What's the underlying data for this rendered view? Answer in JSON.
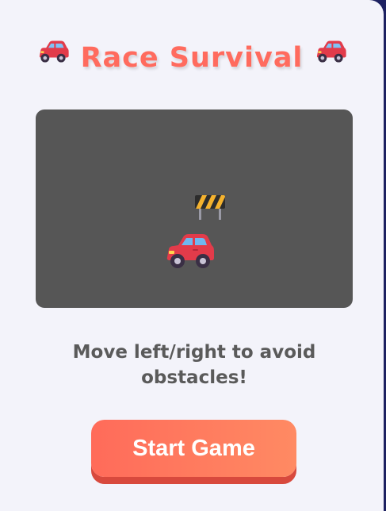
{
  "header": {
    "title": "Race Survival",
    "left_icon": "car-emoji",
    "right_icon": "car-emoji"
  },
  "game": {
    "obstacle_icon": "construction-barrier-emoji",
    "player_icon": "car-emoji"
  },
  "instructions": "Move left/right to avoid obstacles!",
  "start_button": {
    "label": "Start Game"
  },
  "colors": {
    "title": "#ff6b5e",
    "board": "#565656",
    "button_start": "#ff6b5a",
    "button_end": "#ff8a63",
    "button_shadow": "#d8493d",
    "instructions": "#5a5a5a",
    "background": "#f3f3fa"
  }
}
